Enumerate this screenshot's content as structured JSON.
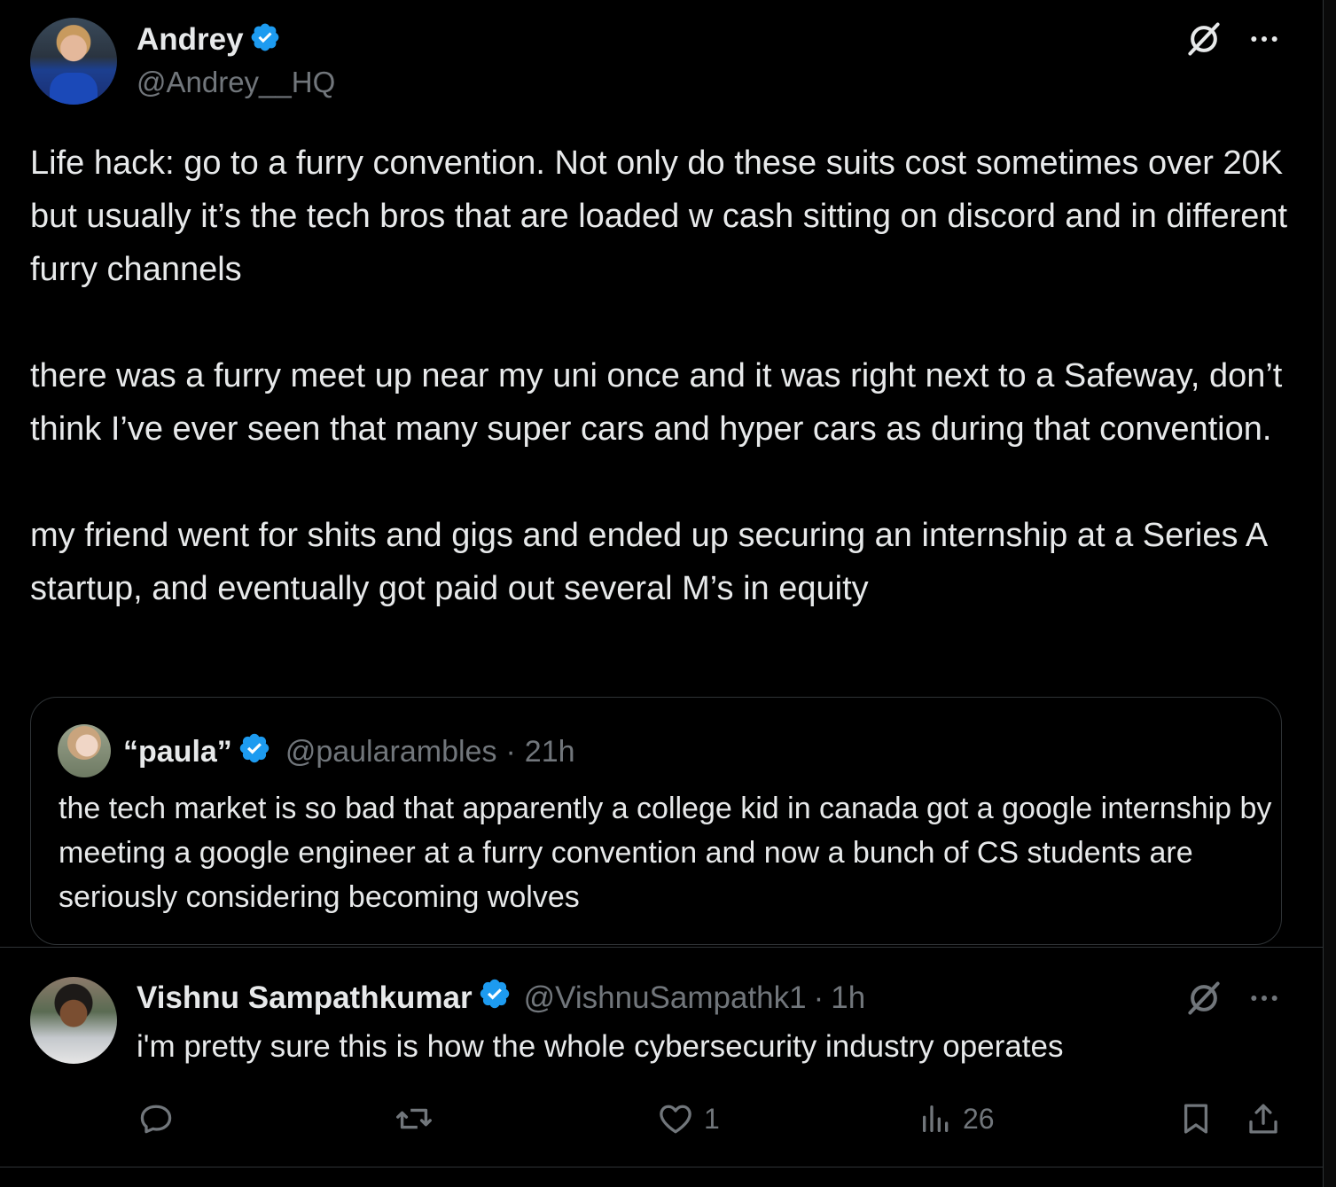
{
  "tweet": {
    "author_name": "Andrey",
    "author_handle": "@Andrey__HQ",
    "paragraphs": [
      "Life hack: go to a furry convention. Not only do these suits cost sometimes over 20K but usually it’s the tech bros that are loaded w cash sitting on discord and in different furry channels",
      "there was a furry meet up near my uni once and it was right next to a Safeway, don’t think I’ve ever seen that many super cars and hyper cars as during that convention.",
      "my friend went for shits and gigs and ended up securing an internship at a Series A startup, and eventually got paid out several M’s in equity"
    ],
    "icons": [
      "grok-icon",
      "more-icon",
      "verified-badge-icon"
    ]
  },
  "quote": {
    "name": "“paula”",
    "handle": "@paularambles",
    "separator": "·",
    "time": "21h",
    "text": "the tech market is so bad that apparently a college kid in canada got a google internship by meeting a google engineer at a furry convention and now a bunch of CS students are seriously considering becoming wolves"
  },
  "reply": {
    "name": "Vishnu Sampathkumar",
    "handle": "@VishnuSampathk1",
    "separator": "·",
    "time": "1h",
    "text": "i'm pretty sure this is how the whole cybersecurity industry operates",
    "actions": {
      "reply_count": "",
      "repost_count": "",
      "like_count": "1",
      "views_count": "26"
    }
  },
  "colors": {
    "background": "#000000",
    "text": "#e7e9ea",
    "muted": "#71767b",
    "border": "#2f3336",
    "verified": "#1d9bf0"
  }
}
